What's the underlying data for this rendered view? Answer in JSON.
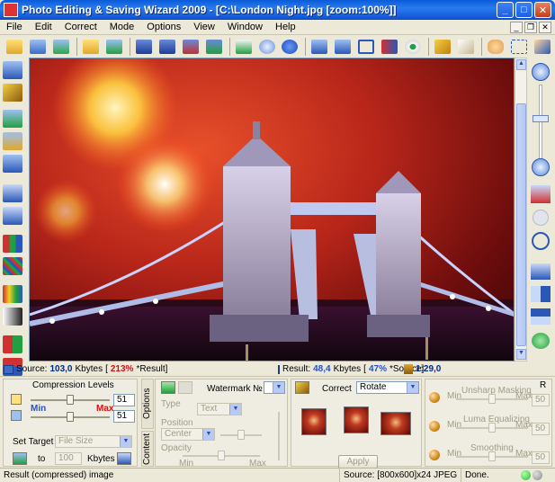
{
  "window": {
    "title": "Photo Editing & Saving Wizard 2009 - [C:\\London Night.jpg  [zoom:100%]]",
    "minimize": "_",
    "maximize": "□",
    "close": "✕"
  },
  "menu": {
    "items": [
      "File",
      "Edit",
      "Correct",
      "Mode",
      "Options",
      "View",
      "Window",
      "Help"
    ],
    "doc_minimize": "_",
    "doc_restore": "❐",
    "doc_close": "✕"
  },
  "toolbar": {
    "groups": [
      [
        "open-folder-icon",
        "open-browse-icon",
        "batch-open-icon"
      ],
      [
        "folder-dropdown-icon",
        "play-run-icon"
      ],
      [
        "save-icon",
        "save-as-icon",
        "save-wizard-icon",
        "export-icon"
      ],
      [
        "email-icon",
        "info-icon",
        "help-icon"
      ],
      [
        "thumbnails-icon",
        "compare-icon",
        "crop-icon",
        "resize-icon",
        "eye-preview-icon"
      ],
      [
        "edit-pen-icon",
        "notes-icon",
        "hand-pan-icon",
        "select-icon",
        "pointer-icon"
      ]
    ]
  },
  "colors": {
    "title_bar": "#0a5bd9",
    "accent_red": "#d41010",
    "accent_blue": "#2450c8",
    "panel": "#ece9d8",
    "led_green": "#1cc21c",
    "led_gray": "#8a8a8a"
  },
  "infobar": {
    "source_label": "Source:",
    "source_size": "103,0",
    "source_unit": "Kbytes",
    "source_percent": "213%",
    "source_ratio_label": "*Result]",
    "result_label": "Result:",
    "result_size": "48,4",
    "result_unit": "Kbytes",
    "result_percent": "47%",
    "result_ratio_label": "*Source]",
    "compression_ratio": "1:29,0"
  },
  "compression": {
    "title": "Compression Levels",
    "value1": "51",
    "value2": "51",
    "min_label": "Min",
    "max_label": "Max",
    "level1_fraction": 0.5,
    "level2_fraction": 0.5
  },
  "target": {
    "label": "Set Target",
    "dropdown": "File Size",
    "to_label": "to",
    "value": "100",
    "unit": "Kbytes"
  },
  "watermark": {
    "tab_options": "Options",
    "tab_content": "Content",
    "title": "Watermark",
    "number_label": "№",
    "type_label": "Type",
    "type_value": "Text",
    "position_label": "Position",
    "position_value": "Center",
    "opacity_label": "Opacity",
    "min_label": "Min",
    "max_label": "Max"
  },
  "correct": {
    "label": "Correct",
    "dropdown": "Rotate",
    "apply": "Apply"
  },
  "adjust": {
    "reset": "R",
    "unsharp_label": "Unsharp Masking",
    "luma_label": "Luma Equalizing",
    "smoothing_label": "Smoothing",
    "min_label": "Min",
    "max_label": "Max",
    "unsharp_value": "50",
    "luma_value": "50",
    "smoothing_value": "50"
  },
  "status": {
    "mode": "Result (compressed) image",
    "source_info": "Source: [800x600]x24 JPEG",
    "state": "Done."
  }
}
